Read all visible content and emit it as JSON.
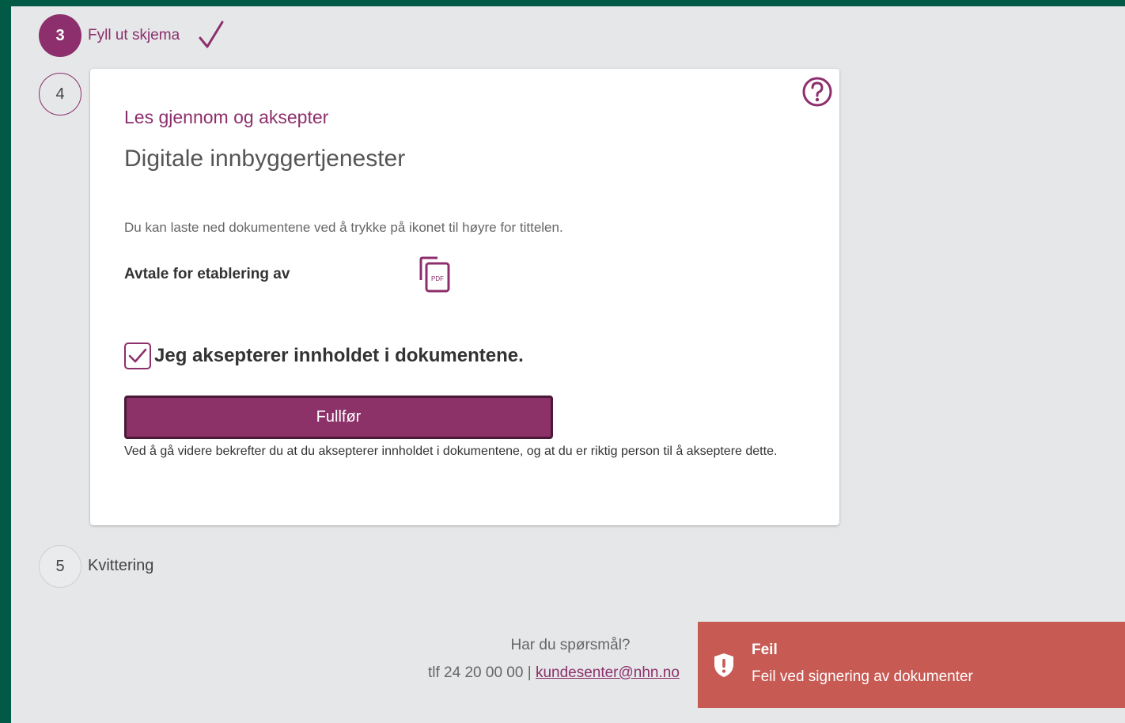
{
  "steps": {
    "step3": {
      "number": "3",
      "label": "Fyll ut skjema"
    },
    "step4": {
      "number": "4"
    },
    "step5": {
      "number": "5",
      "label": "Kvittering"
    }
  },
  "card": {
    "subtitle": "Les gjennom og aksepter",
    "title": "Digitale innbyggertjenester",
    "description": "Du kan laste ned dokumentene ved å trykke på ikonet til høyre for tittelen.",
    "document_title": "Avtale for etablering av",
    "pdf_icon_text": "PDF",
    "accept_label": "Jeg aksepterer innholdet i dokumentene.",
    "accept_checked": true,
    "finish_button": "Fullfør",
    "finish_note": "Ved å gå videre bekrefter du at du aksepterer innholdet i dokumentene, og at du er riktig person til å akseptere dette."
  },
  "footer": {
    "question": "Har du spørsmål?",
    "phone": "tlf 24 20 00 00 | ",
    "email": "kundesenter@nhn.no"
  },
  "toast": {
    "title": "Feil",
    "message": "Feil ved signering av dokumenter"
  },
  "colors": {
    "brand": "#8c2f6c",
    "frame": "#005a45",
    "error": "#c85a54"
  }
}
